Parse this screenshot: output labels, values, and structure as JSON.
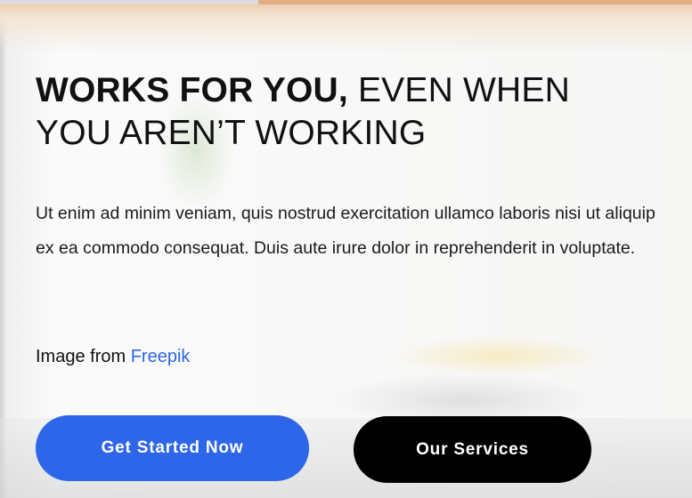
{
  "hero": {
    "title_bold": "WORKS FOR YOU,",
    "title_light_1": " EVEN WHEN",
    "title_light_2": "YOU AREN’T WORKING",
    "paragraph": "Ut enim ad minim veniam, quis nostrud exercitation ullamco laboris nisi ut aliquip ex ea commodo consequat. Duis aute irure dolor in reprehenderit in voluptate.",
    "credit_prefix": "Image from ",
    "credit_link": "Freepik",
    "primary_button": "Get Started Now",
    "secondary_button": "Our Services"
  },
  "colors": {
    "accent": "#2d66e8",
    "secondary": "#000000"
  }
}
